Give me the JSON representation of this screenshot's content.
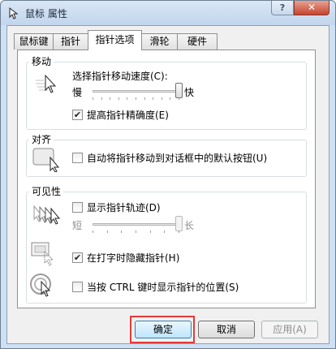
{
  "window": {
    "title": "鼠标 属性",
    "help_label": "?",
    "close_label": "✕"
  },
  "tabs": [
    {
      "label": "鼠标键",
      "active": false
    },
    {
      "label": "指针",
      "active": false
    },
    {
      "label": "指针选项",
      "active": true
    },
    {
      "label": "滑轮",
      "active": false
    },
    {
      "label": "硬件",
      "active": false
    }
  ],
  "motion": {
    "group_label": "移动",
    "speed_label": "选择指针移动速度(C):",
    "slow_label": "慢",
    "fast_label": "快",
    "speed_value": 1.0,
    "precision_label": "提高指针精确度(E)",
    "precision_checked": true
  },
  "snap": {
    "group_label": "对齐",
    "snap_label": "自动将指针移动到对话框中的默认按钮(U)",
    "snap_checked": false
  },
  "visibility": {
    "group_label": "可见性",
    "trails_label": "显示指针轨迹(D)",
    "trails_checked": false,
    "short_label": "短",
    "long_label": "长",
    "trails_value": 1.0,
    "hide_label": "在打字时隐藏指针(H)",
    "hide_checked": true,
    "ctrl_label": "当按 CTRL 键时显示指针的位置(S)",
    "ctrl_checked": false
  },
  "buttons": {
    "ok_label": "确定",
    "cancel_label": "取消",
    "apply_label": "应用(A)"
  },
  "colors": {
    "highlight": "#e33a3a",
    "window_frame": "#cfe0f3",
    "check_mark": "#222222"
  }
}
